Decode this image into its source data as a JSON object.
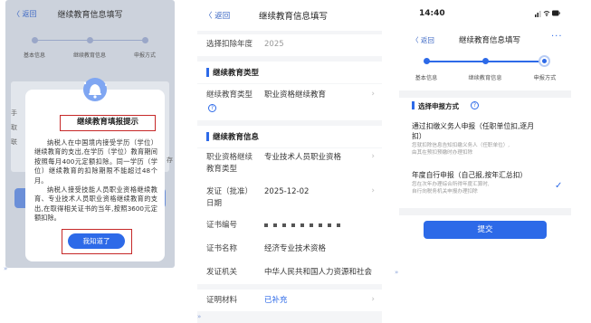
{
  "panel1": {
    "nav": {
      "back": "〈 返回",
      "title": "继续教育信息填写"
    },
    "steps": [
      "基本信息",
      "继续教育信息",
      "申报方式"
    ],
    "bg": {
      "side_labels": [
        "手",
        "取",
        "联"
      ],
      "right_label": "存"
    },
    "modal": {
      "title": "继续教育填报提示",
      "paragraphs": [
        "纳税人在中国境内接受学历（学位）继续教育的支出,在学历（学位）教育期间按照每月400元定额扣除。同一学历（学位）继续教育的扣除期限不能超过48个月。",
        "纳税人接受技能人员职业资格继续教育、专业技术人员职业资格继续教育的支出,在取得相关证书的当年,按照3600元定额扣除。"
      ],
      "ok_button": "我知道了"
    }
  },
  "panel2": {
    "nav": {
      "back": "〈 返回",
      "title": "继续教育信息填写"
    },
    "year_row": {
      "label": "选择扣除年度",
      "value": "2025"
    },
    "section_type": "继续教育类型",
    "edu_type_row": {
      "label": "继续教育类型",
      "value": "职业资格继续教育",
      "help_icon": "question-circle-icon"
    },
    "section_info": "继续教育信息",
    "info_rows": [
      {
        "label": "职业资格继续教育类型",
        "value": "专业技术人员职业资格"
      },
      {
        "label": "发证（批准）日期",
        "value": "2025-12-02"
      },
      {
        "label": "证书编号",
        "value": ""
      },
      {
        "label": "证书名称",
        "value": "经济专业技术资格"
      },
      {
        "label": "发证机关",
        "value": "中华人民共和国人力资源和社会"
      }
    ],
    "material_row": {
      "label": "证明材料",
      "value": "已补充"
    }
  },
  "panel3": {
    "status_bar": {
      "time": "14:40",
      "icons": "signal-wifi-battery-icons"
    },
    "nav": {
      "back": "〈 返回",
      "title": "继续教育信息填写",
      "more": "···"
    },
    "steps": [
      "基本信息",
      "继续教育信息",
      "申报方式"
    ],
    "section_title": "选择申报方式",
    "options": [
      {
        "title_line1": "通过扣缴义务人申报（任职单位扣,逐月",
        "title_line2": "扣）",
        "desc_line1": "您就扣除信息告知扣缴义务人（任职单位）,",
        "desc_line2": "由其在预扣预缴时办理扣除",
        "selected": false
      },
      {
        "title_line1": "年度自行申报（自己报,按年汇总扣）",
        "title_line2": "",
        "desc_line1": "您在次年办理综合所得年度汇算时,",
        "desc_line2": "自行向税务机关申报办理扣除",
        "selected": true
      }
    ],
    "submit_button": "提交",
    "accent": "#2d6ae8"
  }
}
